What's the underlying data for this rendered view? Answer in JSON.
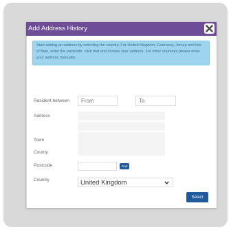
{
  "dialog": {
    "title": "Add Address History",
    "close_icon": "close-icon",
    "accent_color": "#6e4d96",
    "button_color": "#1f5a9c",
    "info_color": "#9fd4ee"
  },
  "info_text": "Start adding an address by selecting the country. For United Kingdom, Guernsey, Jersey and Isle of Man, enter the postcode, click find and choose your address. For other countries please enter your address manually.",
  "form": {
    "resident_label": "Resident between",
    "from_placeholder": "From",
    "to_placeholder": "To",
    "address_label": "Address",
    "town_label": "Town",
    "county_label": "County",
    "postcode_label": "Postcode",
    "find_label": "Find",
    "country_label": "Country",
    "country_value": "United Kingdom",
    "select_label": "Select"
  }
}
